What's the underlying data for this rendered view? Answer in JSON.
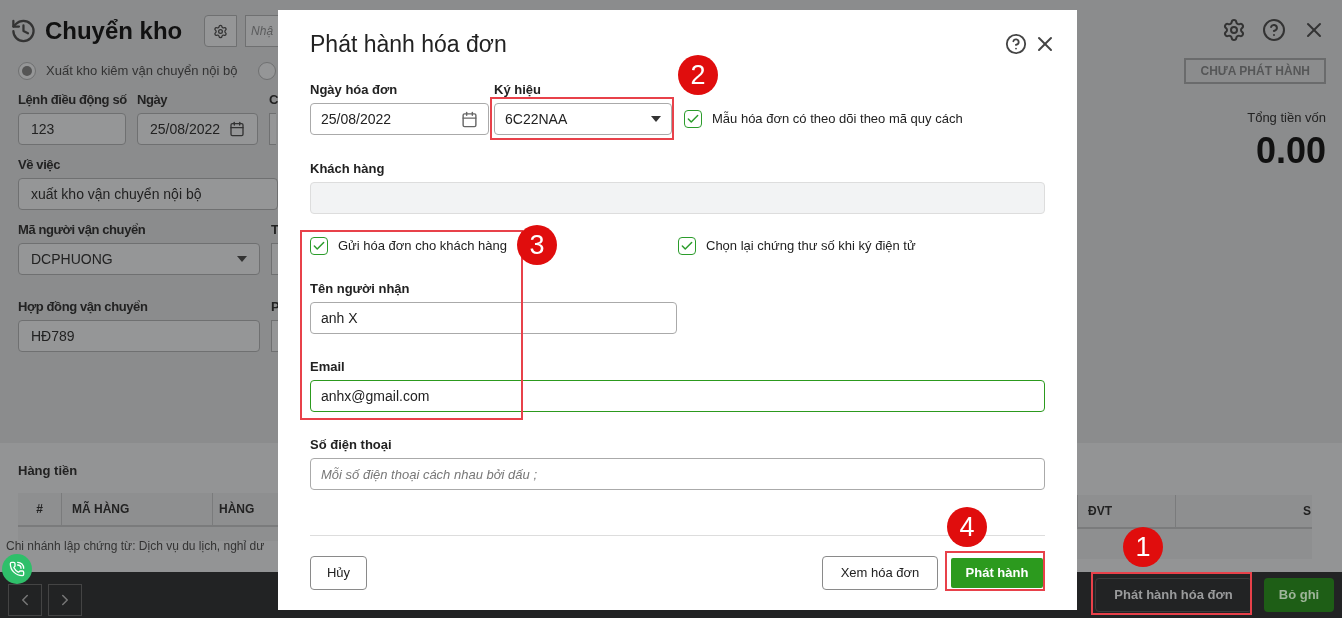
{
  "page": {
    "title": "Chuyển kho",
    "search_placeholder": "Nhậ",
    "radios": [
      {
        "label": "Xuất kho kiêm vận chuyển nội bộ",
        "selected": true
      },
      {
        "selected": false
      }
    ],
    "field_rows": [
      [
        {
          "kind": "short",
          "label": "Lệnh điều động số",
          "value": "123"
        },
        {
          "kind": "date",
          "label": "Ngày",
          "value": "25/08/2022"
        },
        {
          "kind": "stub",
          "label": "C"
        }
      ],
      [
        {
          "kind": "wide",
          "label": "Về việc",
          "value": "xuất kho vận chuyển nội bộ"
        }
      ],
      [
        {
          "kind": "select",
          "label": "Mã người vận chuyển",
          "value": "DCPHUONG"
        },
        {
          "kind": "stub",
          "label": "T"
        }
      ],
      [
        {
          "kind": "text",
          "label": "Hợp đồng vận chuyển",
          "value": "HĐ789"
        },
        {
          "kind": "stub",
          "label": "P"
        }
      ]
    ],
    "status_badge": "CHƯA PHÁT HÀNH",
    "total_label": "Tổng tiền vốn",
    "total_value": "0.00",
    "section_title": "Hàng tiền",
    "table_columns_left": [
      "#",
      "MÃ HÀNG",
      "HÀNG"
    ],
    "table_columns_right": [
      "ĐVT",
      "S"
    ],
    "footer_note": "Chi nhánh lập chứng từ: Dịch vụ du lịch, nghỉ dư",
    "buttons": [
      {
        "label": "Phát hành hóa đơn",
        "kind": "dark"
      },
      {
        "label": "Bỏ ghi",
        "kind": "green"
      }
    ]
  },
  "dialog": {
    "title": "Phát hành hóa đơn",
    "invoice_date": {
      "label": "Ngày hóa đơn",
      "value": "25/08/2022"
    },
    "symbol": {
      "label": "Ký hiệu",
      "value": "6C22NAA"
    },
    "track_spec": {
      "label": "Mẫu hóa đơn có theo dõi theo mã quy cách",
      "checked": true
    },
    "customer": {
      "label": "Khách hàng"
    },
    "send_to_customer": {
      "label": "Gửi hóa đơn cho khách hàng",
      "checked": true
    },
    "reselect_cert": {
      "label": "Chọn lại chứng thư số khi ký điện tử",
      "checked": true
    },
    "recipient": {
      "label": "Tên người nhận",
      "value": "anh X"
    },
    "email": {
      "label": "Email",
      "value": "anhx@gmail.com"
    },
    "phone": {
      "label": "Số điện thoại",
      "placeholder": "Mỗi số điện thoại cách nhau bởi dấu ;"
    },
    "buttons": [
      {
        "label": "Hủy",
        "kind": "plain"
      },
      {
        "label": "Xem hóa đơn",
        "kind": "plain"
      },
      {
        "label": "Phát hành",
        "kind": "primary"
      }
    ]
  },
  "annotations": [
    {
      "label": "1"
    },
    {
      "label": "2"
    },
    {
      "label": "3"
    },
    {
      "label": "4"
    }
  ]
}
